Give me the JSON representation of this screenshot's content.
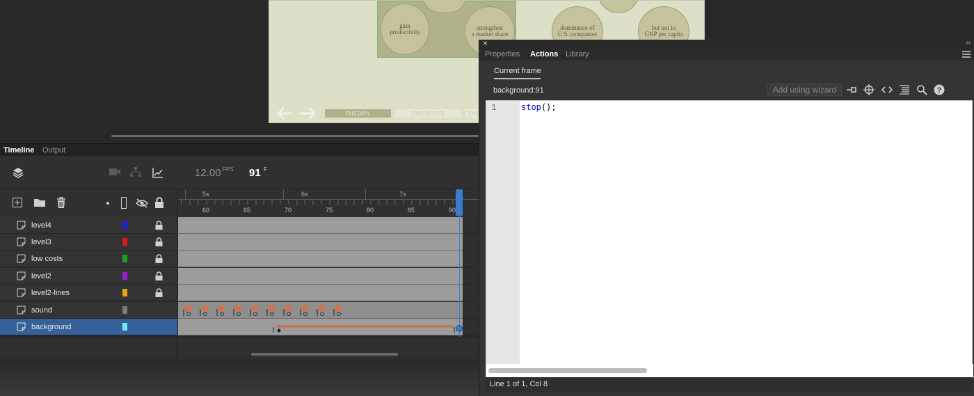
{
  "stage": {
    "bubbles": [
      {
        "text": "gain\nproductivity"
      },
      {
        "text": "strengthen\na market share"
      },
      {
        "text": "dominance of\nU.S. companies"
      },
      {
        "text": "but not in\nGNP per capita"
      }
    ],
    "nav": {
      "theory": "THEORY",
      "projects": "PROJECTS",
      "partial": "THE"
    }
  },
  "timeline": {
    "tabs": [
      {
        "label": "Timeline",
        "active": true
      },
      {
        "label": "Output",
        "active": false
      }
    ],
    "fps": "12.00",
    "fps_unit": "FPS",
    "frame": "91",
    "frame_unit": "F",
    "ruler_seconds": [
      "5s",
      "6s",
      "7s"
    ],
    "ruler_frames": [
      "60",
      "65",
      "70",
      "75",
      "80",
      "85",
      "90"
    ],
    "layers": [
      {
        "name": "level4",
        "color": "#1f1fe0",
        "locked": true,
        "selected": false
      },
      {
        "name": "level3",
        "color": "#e01818",
        "locked": true,
        "selected": false
      },
      {
        "name": "low costs",
        "color": "#1aa21a",
        "locked": true,
        "selected": false
      },
      {
        "name": "level2",
        "color": "#9a1ad8",
        "locked": true,
        "selected": false
      },
      {
        "name": "level2-lines",
        "color": "#f0a010",
        "locked": true,
        "selected": false
      },
      {
        "name": "sound",
        "color": "#7a7a7a",
        "locked": false,
        "selected": false
      },
      {
        "name": "background",
        "color": "#6fe9f3",
        "locked": false,
        "selected": true
      }
    ],
    "accent": "#3b7cd1"
  },
  "actions_panel": {
    "tabs": [
      {
        "label": "Properties",
        "active": false
      },
      {
        "label": "Actions",
        "active": true
      },
      {
        "label": "Library",
        "active": false
      }
    ],
    "subtab": "Current frame",
    "frame_key": "background:91",
    "wizard_label": "Add using wizard",
    "tools": [
      "pin-icon",
      "target-icon",
      "code-brackets-icon",
      "format-icon",
      "find-icon",
      "help-icon"
    ],
    "line_number": "1",
    "code_fn": "stop",
    "code_rest": "();",
    "status": "Line 1 of 1, Col 8"
  }
}
